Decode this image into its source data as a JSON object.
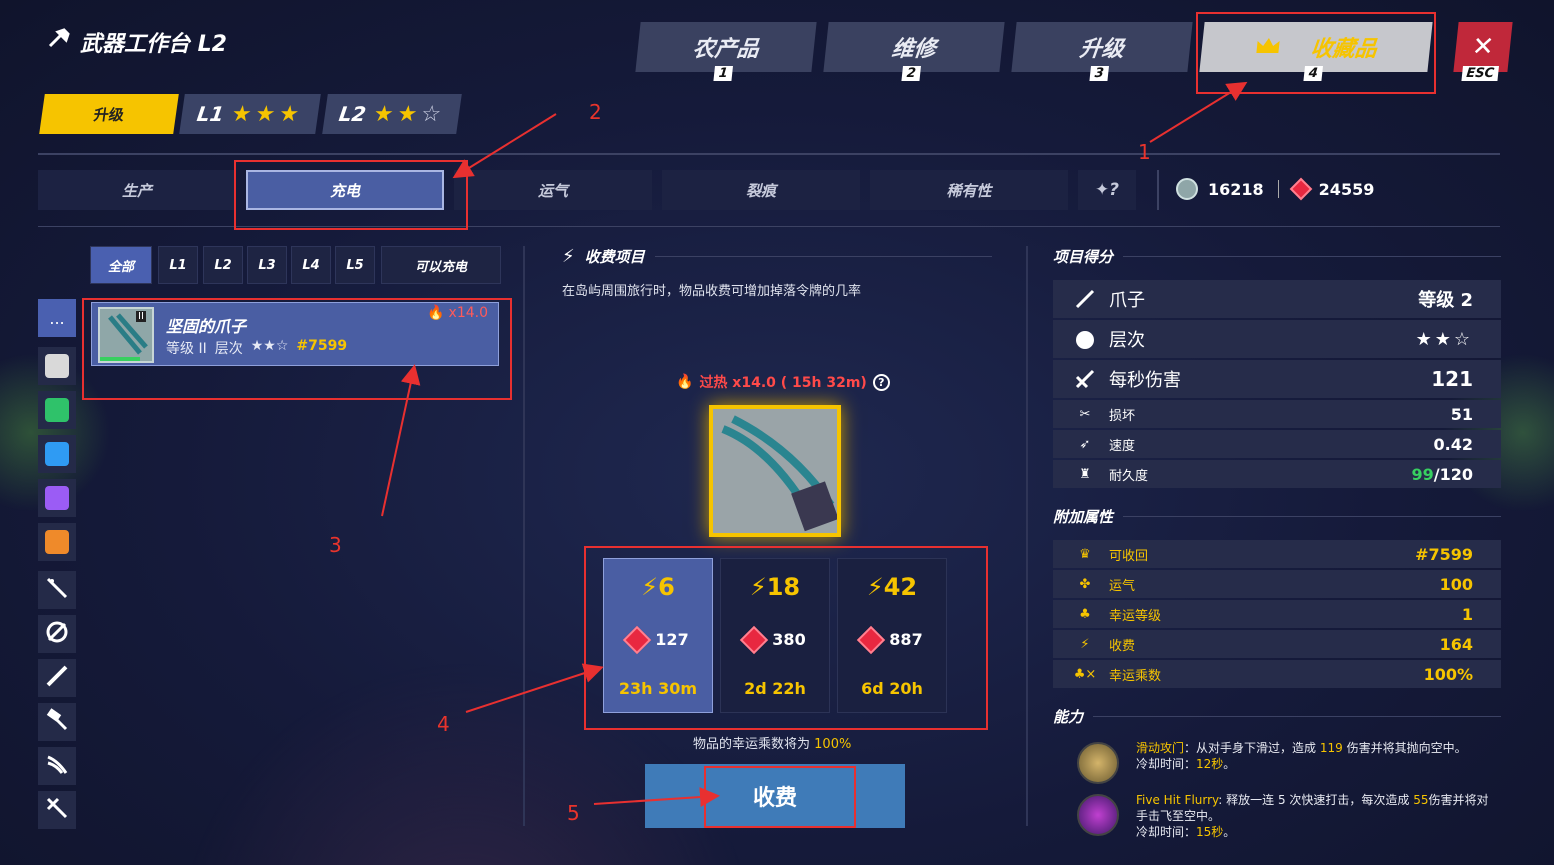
{
  "header": {
    "title": "武器工作台 L2",
    "title_icon": "hammer-icon"
  },
  "top_tabs": [
    {
      "label": "农产品",
      "key": "1"
    },
    {
      "label": "维修",
      "key": "2"
    },
    {
      "label": "升级",
      "key": "3"
    },
    {
      "label": "收藏品",
      "key": "4",
      "icon": "crown-icon"
    }
  ],
  "close": {
    "label": "✕",
    "key": "ESC"
  },
  "level_tabs": {
    "upgrade": "升级",
    "l1": "L1",
    "l2": "L2"
  },
  "sub_tabs": [
    "生产",
    "充电",
    "运气",
    "裂痕",
    "稀有性"
  ],
  "currency": {
    "coins": "16218",
    "gems": "24559"
  },
  "filters": [
    "全部",
    "L1",
    "L2",
    "L3",
    "L4",
    "L5",
    "可以充电"
  ],
  "sidebar": {
    "more": "...",
    "swatch_colors": [
      "#d9d9d9",
      "#2fc26a",
      "#2f9bf3",
      "#9b5cf5",
      "#ef8a2a"
    ]
  },
  "item": {
    "name": "坚固的爪子",
    "meta_level": "等级 II",
    "meta_tier": "层次",
    "stars": "★★☆",
    "id": "#7599",
    "multiplier": "x14.0",
    "badge": "II"
  },
  "charge": {
    "section_title": "收费项目",
    "description": "在岛屿周围旅行时，物品收费可增加掉落令牌的几率",
    "overheat": "过热 x14.0 ( 15h 32m)",
    "options": [
      {
        "charge": "6",
        "cost": "127",
        "time": "23h 30m"
      },
      {
        "charge": "18",
        "cost": "380",
        "time": "2d 22h"
      },
      {
        "charge": "42",
        "cost": "887",
        "time": "6d 20h"
      }
    ],
    "luck_note": "物品的幸运乘数将为",
    "luck_value": "100%",
    "button": "收费"
  },
  "scores": {
    "title": "项目得分",
    "main": [
      {
        "label": "爪子",
        "value": "等级 2"
      },
      {
        "label": "层次",
        "value": "★★☆"
      },
      {
        "label": "每秒伤害",
        "value": "121"
      }
    ],
    "sub": [
      {
        "label": "损坏",
        "value": "51"
      },
      {
        "label": "速度",
        "value": "0.42"
      }
    ],
    "durability": {
      "label": "耐久度",
      "current": "99",
      "max": "/120"
    }
  },
  "extra": {
    "title": "附加属性",
    "rows": [
      {
        "label": "可收回",
        "value": "#7599"
      },
      {
        "label": "运气",
        "value": "100"
      },
      {
        "label": "幸运等级",
        "value": "1"
      },
      {
        "label": "收费",
        "value": "164"
      },
      {
        "label": "幸运乘数",
        "value": "100%"
      }
    ]
  },
  "abilities": {
    "title": "能力",
    "items": [
      {
        "name": "滑动攻门",
        "pre": "：从对手身下滑过，造成 ",
        "num": "119",
        "post": " 伤害并将其抛向空中。",
        "cd_pre": "冷却时间：",
        "cd": "12秒",
        "cd_post": "。"
      },
      {
        "name": "Five Hit Flurry",
        "pre": ": 释放一连 5 次快速打击，每次造成 ",
        "num": "55",
        "post": "伤害并将对手击飞至空中。",
        "cd_pre": "冷却时间：",
        "cd": "15秒",
        "cd_post": "。"
      }
    ]
  },
  "annotations": [
    "1",
    "2",
    "3",
    "4",
    "5"
  ]
}
